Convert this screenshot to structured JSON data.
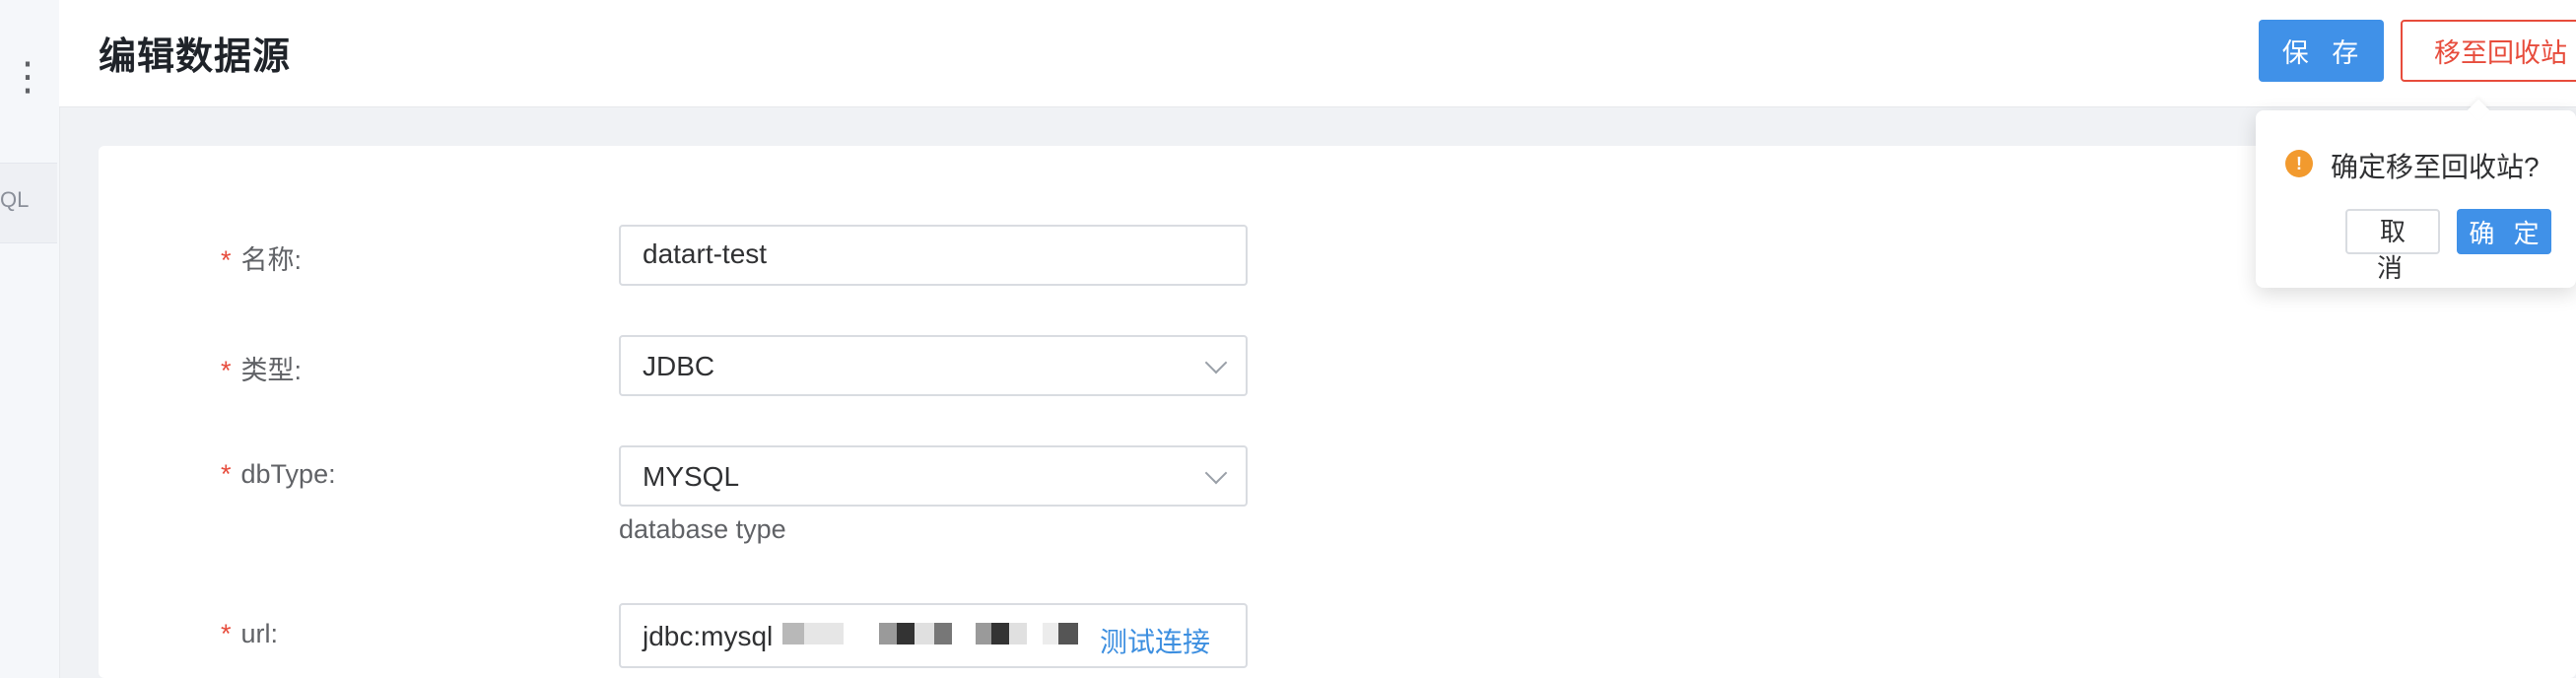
{
  "sidebar": {
    "more_icon": "vertical-dots-icon",
    "item_label": "QL"
  },
  "header": {
    "title": "编辑数据源",
    "save_label": "保 存",
    "recycle_label": "移至回收站"
  },
  "form": {
    "name_label": "名称:",
    "name_value": "datart-test",
    "type_label": "类型:",
    "type_value": "JDBC",
    "dbtype_label": "dbType:",
    "dbtype_value": "MYSQL",
    "dbtype_help": "database type",
    "url_label": "url:",
    "url_value": "jdbc:mysql",
    "url_test_link": "测试连接",
    "required_mark": "*"
  },
  "popconfirm": {
    "icon": "warning-icon",
    "icon_glyph": "!",
    "message": "确定移至回收站?",
    "cancel_label": "取 消",
    "confirm_label": "确 定"
  },
  "colors": {
    "primary": "#4091e8",
    "danger": "#e74c3c",
    "warning": "#f29a2e"
  }
}
